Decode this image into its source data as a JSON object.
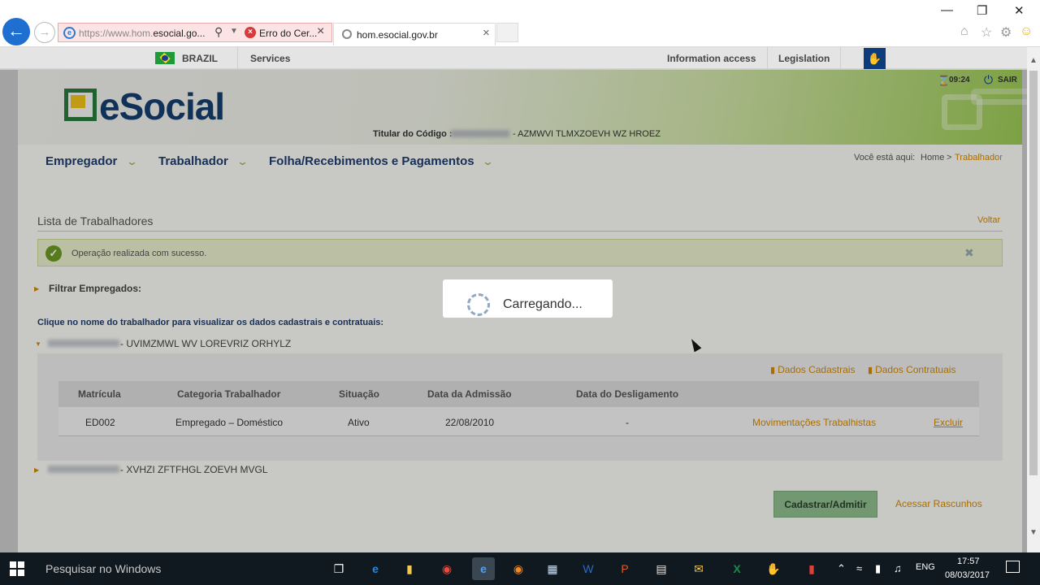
{
  "browser": {
    "url_prefix": "https://www.hom.",
    "url_main": "esocial.go...",
    "cert_error": "Erro do Cer...",
    "tab_title": "hom.esocial.gov.br"
  },
  "govbar": {
    "country": "BRAZIL",
    "services": "Services",
    "information_access": "Information access",
    "legislation": "Legislation"
  },
  "header": {
    "logo": "eSocial",
    "titular_label": "Titular do Código :",
    "titular_name": "- AZMWVI TLMXZOEVH WZ HROEZ",
    "timer": "09:24",
    "logout": "SAIR"
  },
  "nav": {
    "menu": [
      "Empregador",
      "Trabalhador",
      "Folha/Recebimentos e Pagamentos"
    ],
    "breadcrumb_label": "Você está aqui:",
    "breadcrumb_home": "Home",
    "breadcrumb_sep": ">",
    "breadcrumb_current": "Trabalhador"
  },
  "main": {
    "title": "Lista de Trabalhadores",
    "back": "Voltar",
    "success_message": "Operação realizada com sucesso.",
    "filter_label": "Filtrar Empregados:",
    "instruction": "Clique no nome do trabalhador para visualizar os dados cadastrais e contratuais:",
    "workers": [
      {
        "name": "- UVIMZMWL WV LOREVRIZ ORHYLZ"
      },
      {
        "name": "- XVHZI ZFTFHGL ZOEVH MVGL"
      }
    ],
    "links": {
      "dados_cadastrais": "Dados Cadastrais",
      "dados_contratuais": "Dados Contratuais"
    },
    "table": {
      "headers": [
        "Matrícula",
        "Categoria Trabalhador",
        "Situação",
        "Data da Admissão",
        "Data do Desligamento"
      ],
      "row": {
        "matricula": "ED002",
        "categoria": "Empregado – Doméstico",
        "situacao": "Ativo",
        "admissao": "22/08/2010",
        "desligamento": "-",
        "movimentacoes": "Movimentações Trabalhistas",
        "excluir": "Excluir"
      }
    },
    "btn_cadastrar": "Cadastrar/Admitir",
    "btn_rascunhos": "Acessar Rascunhos"
  },
  "loader": {
    "text": "Carregando..."
  },
  "taskbar": {
    "search_placeholder": "Pesquisar no Windows",
    "language": "ENG",
    "time": "17:57",
    "date": "08/03/2017"
  },
  "colors": {
    "accent": "#d38a06",
    "nav_text": "#1f3c6c",
    "success_bg": "#eaf1cd"
  }
}
